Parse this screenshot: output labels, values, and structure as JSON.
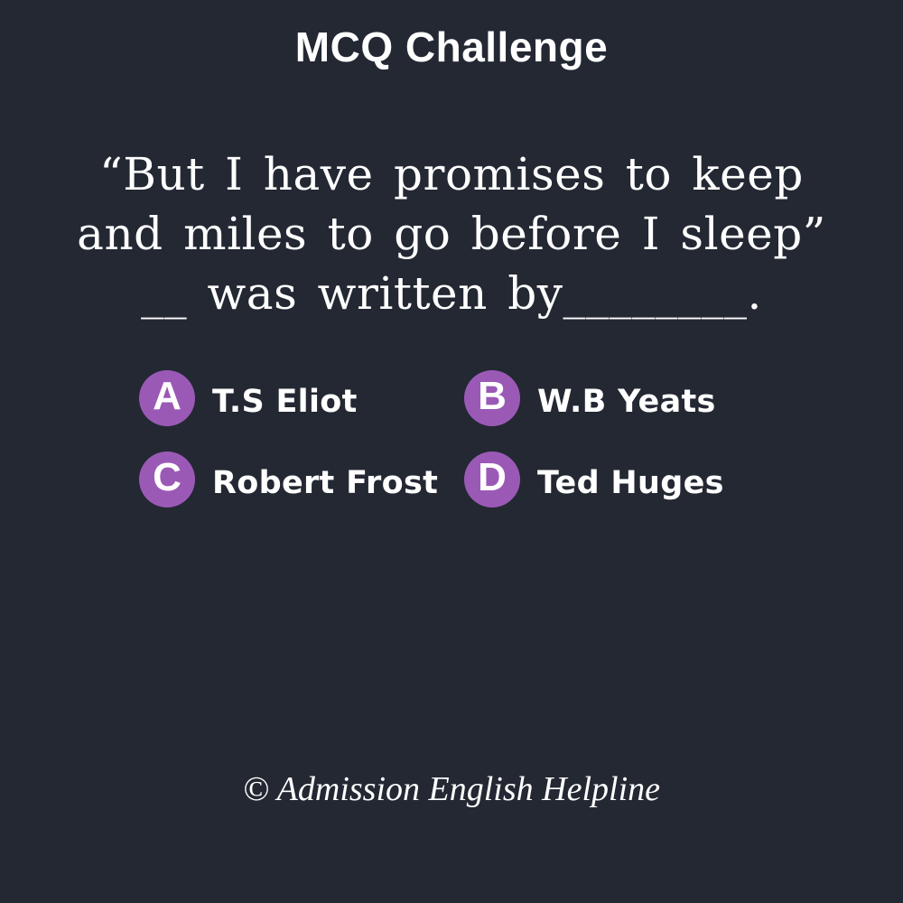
{
  "header": {
    "title": "MCQ Challenge"
  },
  "question": {
    "text": "“But I have promises to keep and miles to go before I sleep” __ was written by________."
  },
  "options": [
    {
      "letter": "A",
      "text": "T.S Eliot"
    },
    {
      "letter": "B",
      "text": "W.B Yeats"
    },
    {
      "letter": "C",
      "text": "Robert Frost"
    },
    {
      "letter": "D",
      "text": "Ted Huges"
    }
  ],
  "footer": {
    "credit": "© Admission English Helpline"
  },
  "colors": {
    "background": "#232833",
    "badge": "#9b59b6",
    "text": "#ffffff"
  }
}
